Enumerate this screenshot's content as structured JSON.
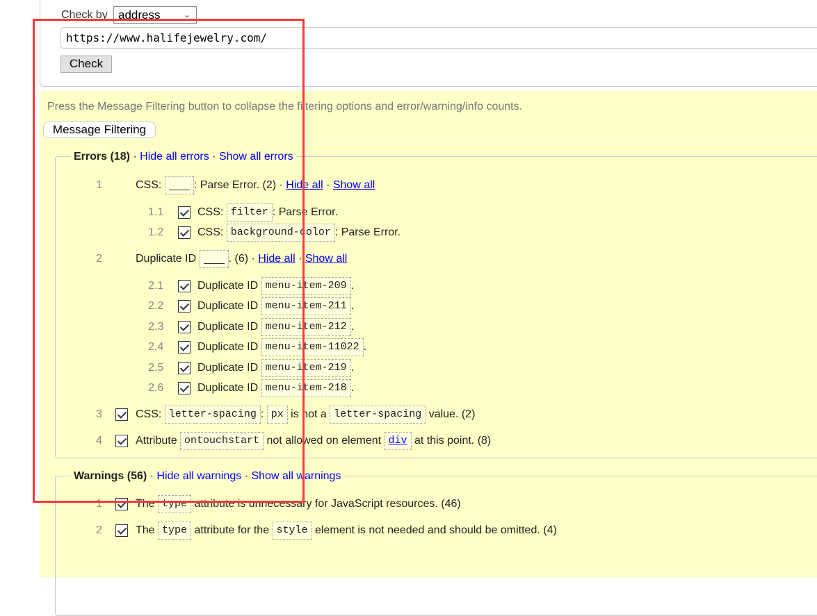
{
  "form": {
    "check_by_label": "Check by",
    "check_by_value": "address",
    "url": "https://www.halifejewelry.com/",
    "check_button": "Check"
  },
  "results": {
    "hint": "Press the Message Filtering button to collapse the filtering options and error/warning/info counts.",
    "filter_button": "Message Filtering",
    "errors": {
      "title": "Errors (18)",
      "hide_all": "Hide all errors",
      "show_all": "Show all errors",
      "rows": [
        {
          "num": "1",
          "level": 0,
          "check": false,
          "segs": [
            {
              "t": "CSS: "
            },
            {
              "blank": true
            },
            {
              "t": ": Parse Error. (2) · "
            },
            {
              "l": "Hide all"
            },
            {
              "t": " · "
            },
            {
              "l": "Show all"
            }
          ]
        },
        {
          "num": "1.1",
          "level": 1,
          "check": true,
          "segs": [
            {
              "t": "CSS: "
            },
            {
              "c": "filter"
            },
            {
              "t": ": Parse Error."
            }
          ]
        },
        {
          "num": "1.2",
          "level": 1,
          "check": true,
          "segs": [
            {
              "t": "CSS: "
            },
            {
              "c": "background-color"
            },
            {
              "t": ": Parse Error."
            }
          ]
        },
        {
          "num": "2",
          "level": 0,
          "check": false,
          "segs": [
            {
              "t": "Duplicate ID "
            },
            {
              "blank": true
            },
            {
              "t": ". (6) · "
            },
            {
              "l": "Hide all"
            },
            {
              "t": " · "
            },
            {
              "l": "Show all"
            }
          ]
        },
        {
          "num": "2.1",
          "level": 1,
          "check": true,
          "segs": [
            {
              "t": "Duplicate ID "
            },
            {
              "c": "menu-item-209"
            },
            {
              "t": "."
            }
          ]
        },
        {
          "num": "2.2",
          "level": 1,
          "check": true,
          "segs": [
            {
              "t": "Duplicate ID "
            },
            {
              "c": "menu-item-211"
            },
            {
              "t": "."
            }
          ]
        },
        {
          "num": "2.3",
          "level": 1,
          "check": true,
          "segs": [
            {
              "t": "Duplicate ID "
            },
            {
              "c": "menu-item-212"
            },
            {
              "t": "."
            }
          ]
        },
        {
          "num": "2.4",
          "level": 1,
          "check": true,
          "segs": [
            {
              "t": "Duplicate ID "
            },
            {
              "c": "menu-item-11022"
            },
            {
              "t": "."
            }
          ]
        },
        {
          "num": "2.5",
          "level": 1,
          "check": true,
          "segs": [
            {
              "t": "Duplicate ID "
            },
            {
              "c": "menu-item-219"
            },
            {
              "t": "."
            }
          ]
        },
        {
          "num": "2.6",
          "level": 1,
          "check": true,
          "segs": [
            {
              "t": "Duplicate ID "
            },
            {
              "c": "menu-item-218"
            },
            {
              "t": "."
            }
          ]
        },
        {
          "num": "3",
          "level": 0,
          "check": true,
          "segs": [
            {
              "t": "CSS: "
            },
            {
              "c": "letter-spacing"
            },
            {
              "t": ": "
            },
            {
              "c": "px"
            },
            {
              "t": " is not a "
            },
            {
              "c": "letter-spacing"
            },
            {
              "t": " value. (2)"
            }
          ]
        },
        {
          "num": "4",
          "level": 0,
          "check": true,
          "segs": [
            {
              "t": "Attribute "
            },
            {
              "c": "ontouchstart"
            },
            {
              "t": " not allowed on element "
            },
            {
              "cl": "div"
            },
            {
              "t": " at this point. (8)"
            }
          ]
        }
      ]
    },
    "warnings": {
      "title": "Warnings (56)",
      "hide_all": "Hide all warnings",
      "show_all": "Show all warnings",
      "rows": [
        {
          "num": "1",
          "level": 0,
          "check": true,
          "segs": [
            {
              "t": "The "
            },
            {
              "c": "type"
            },
            {
              "t": " attribute is unnecessary for JavaScript resources. (46)"
            }
          ]
        },
        {
          "num": "2",
          "level": 0,
          "check": true,
          "segs": [
            {
              "t": "The "
            },
            {
              "c": "type"
            },
            {
              "t": " attribute for the "
            },
            {
              "c": "style"
            },
            {
              "t": " element is not needed and should be omitted. (4)"
            }
          ]
        }
      ]
    }
  },
  "colors": {
    "results_bg": "#ffffc8",
    "link": "#0000ff",
    "annotation_box": "#f03c3c"
  }
}
